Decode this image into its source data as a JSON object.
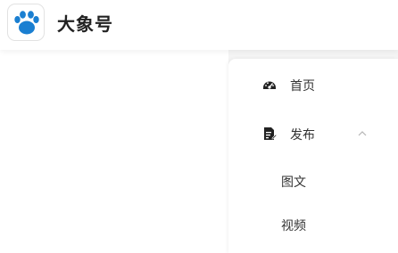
{
  "header": {
    "brand": "大象号"
  },
  "sidebar": {
    "items": [
      {
        "label": "首页",
        "icon": "dashboard-icon"
      },
      {
        "label": "发布",
        "icon": "publish-icon",
        "expanded": true
      },
      {
        "label": "图文"
      },
      {
        "label": "视频"
      }
    ]
  },
  "colors": {
    "brand_blue": "#1a7fd1",
    "text": "#333333",
    "icon": "#222222"
  }
}
